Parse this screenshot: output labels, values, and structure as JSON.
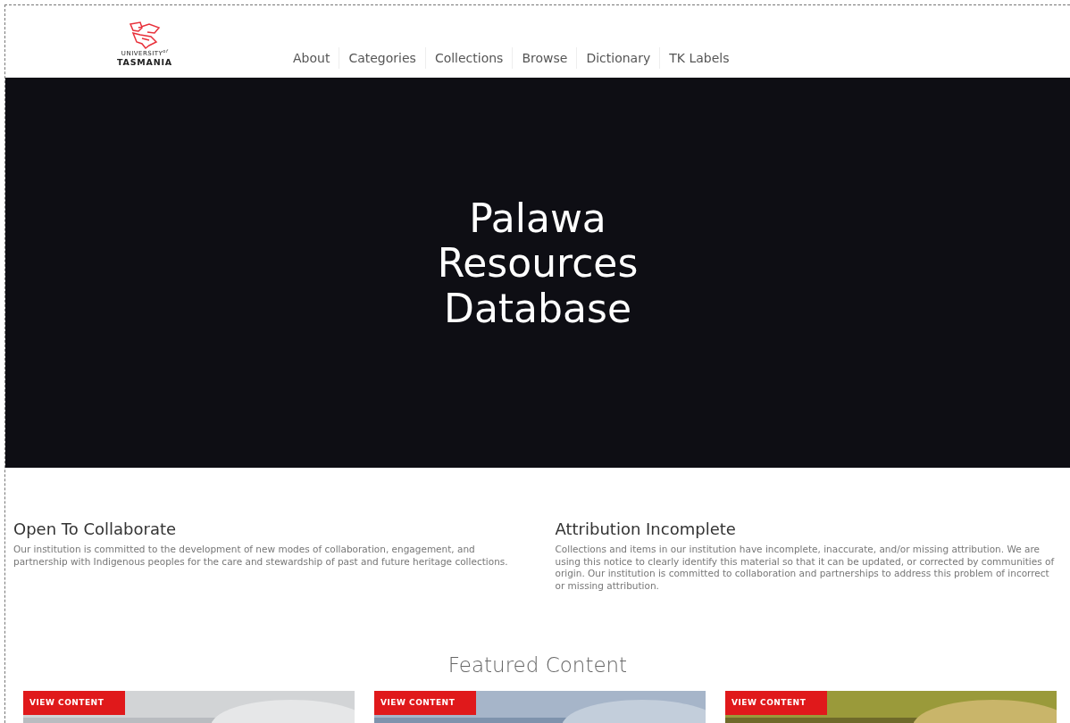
{
  "logo": {
    "line1": "UNIVERSITY$^{of}$",
    "line2": "TASMANIA"
  },
  "nav": [
    "About",
    "Categories",
    "Collections",
    "Browse",
    "Dictionary",
    "TK Labels"
  ],
  "hero": {
    "title": "Palawa Resources Database"
  },
  "notices": [
    {
      "title": "Open To Collaborate",
      "text": "Our institution is committed to the development of new modes of collaboration, engagement, and partnership with Indigenous peoples for the care and stewardship of past and future heritage collections."
    },
    {
      "title": "Attribution Incomplete",
      "text": "Collections and items in our institution have incomplete, inaccurate, and/or missing attribution. We are using this notice to clearly identify this material so that it can be updated, or corrected by communities of origin. Our institution is committed to collaboration and partnerships to address this problem of incorrect or missing attribution."
    }
  ],
  "featured": {
    "title": "Featured Content",
    "cards": [
      {
        "button": "VIEW CONTENT",
        "kind": "picture"
      },
      {
        "button": "VIEW CONTENT",
        "kind": "picture"
      },
      {
        "button": "VIEW CONTENT",
        "kind": "picture"
      }
    ]
  }
}
